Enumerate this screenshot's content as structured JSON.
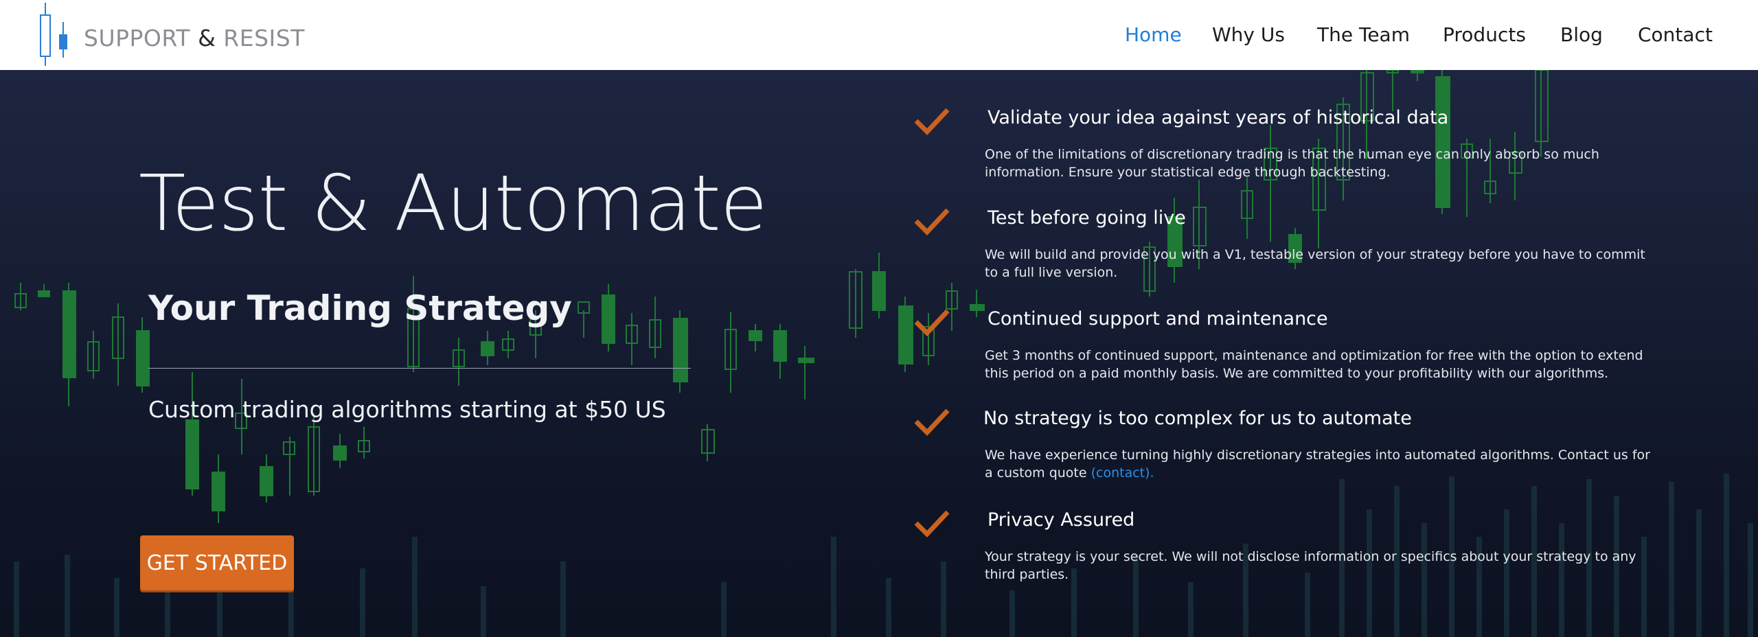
{
  "header": {
    "logo": {
      "word1": "SUPPORT",
      "amp": "&",
      "word2": "RESIST"
    },
    "nav": [
      {
        "label": "Home",
        "active": true
      },
      {
        "label": "Why Us",
        "active": false
      },
      {
        "label": "The Team",
        "active": false
      },
      {
        "label": "Products",
        "active": false
      },
      {
        "label": "Blog",
        "active": false
      },
      {
        "label": "Contact",
        "active": false
      }
    ]
  },
  "hero": {
    "title": "Test & Automate",
    "subtitle": "Your Trading Strategy",
    "tagline": "Custom trading algorithms starting at $50 US",
    "cta_label": "GET STARTED",
    "background": "candlestick-chart-background"
  },
  "features": [
    {
      "icon": "checkmark-icon",
      "title": "Validate your idea against years of historical data",
      "description": "One of the limitations of discretionary trading is that the human eye can only absorb so much information. Ensure your statistical edge through backtesting."
    },
    {
      "icon": "checkmark-icon",
      "title": "Test before going live",
      "description": "We will build and provide you with a V1, testable version of your strategy before you have to commit to a full live version."
    },
    {
      "icon": "checkmark-icon",
      "title": "Continued support and maintenance",
      "description": "Get 3 months of continued support, maintenance and optimization for free with the option to extend this period on a paid monthly basis. We are committed to your profitability with our algorithms."
    },
    {
      "icon": "checkmark-icon",
      "title": "No strategy is too complex for us to automate",
      "description": "We have experience turning highly discretionary strategies into automated algorithms. Contact us for a custom quote ",
      "link": "(contact)."
    },
    {
      "icon": "checkmark-icon",
      "title": "Privacy Assured",
      "description": "Your strategy is your secret. We will not disclose information or specifics about your strategy to any third parties."
    }
  ],
  "colors": {
    "accent_orange": "#d96a22",
    "nav_active": "#1e7fd8",
    "candle_green": "#1e7a35",
    "background_dark": "#131a2e"
  }
}
